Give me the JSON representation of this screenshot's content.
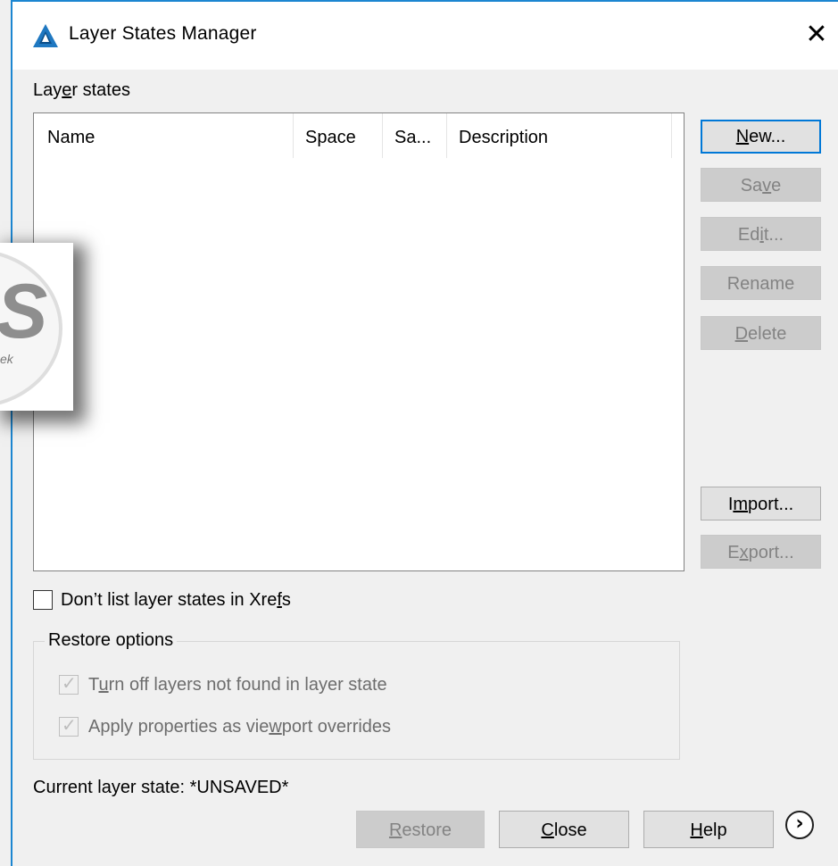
{
  "window": {
    "title": "Layer States Manager",
    "close_glyph": "✕",
    "app_icon": "autocad-triangle-icon"
  },
  "list": {
    "label_prefix": "Lay",
    "label_underlined": "e",
    "label_suffix": "r states",
    "columns": [
      "Name",
      "Space",
      "Sa...",
      "Description"
    ],
    "rows": []
  },
  "buttons": {
    "new": {
      "prefix": "",
      "underlined": "N",
      "suffix": "ew..."
    },
    "save": {
      "prefix": "Sa",
      "underlined": "v",
      "suffix": "e"
    },
    "edit": {
      "prefix": "Ed",
      "underlined": "i",
      "suffix": "t..."
    },
    "rename": {
      "prefix": "Rename",
      "underlined": "",
      "suffix": ""
    },
    "delete": {
      "prefix": "",
      "underlined": "D",
      "suffix": "elete"
    },
    "import": {
      "prefix": "I",
      "underlined": "m",
      "suffix": "port..."
    },
    "export": {
      "prefix": "E",
      "underlined": "x",
      "suffix": "port..."
    },
    "restore": {
      "prefix": "",
      "underlined": "R",
      "suffix": "estore"
    },
    "close": {
      "prefix": "",
      "underlined": "C",
      "suffix": "lose"
    },
    "help": {
      "prefix": "",
      "underlined": "H",
      "suffix": "elp"
    },
    "more_glyph": "›"
  },
  "options": {
    "dont_list_xrefs": {
      "prefix": "Don’t list layer states in Xre",
      "underlined": "f",
      "suffix": "s",
      "checked": false
    },
    "restore_options_title": "Restore options",
    "turn_off_layers": {
      "prefix": "T",
      "underlined": "u",
      "suffix": "rn off layers not found in layer state",
      "checked": true
    },
    "apply_viewport": {
      "prefix": "Apply properties as vie",
      "underlined": "w",
      "suffix": "port overrides",
      "checked": true
    }
  },
  "status": {
    "current_layer_state": "Current layer state: *UNSAVED*"
  },
  "watermark": {
    "letter": "S",
    "small_text": "ek"
  },
  "colors": {
    "accent": "#0078d7",
    "app_icon": "#1f78c1",
    "border": "#1c86d1"
  }
}
